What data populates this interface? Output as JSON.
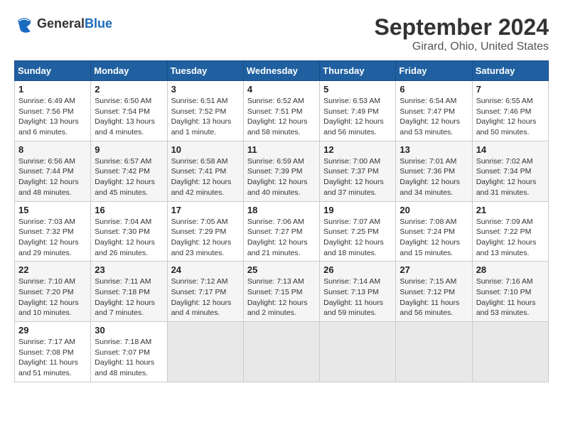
{
  "logo": {
    "general": "General",
    "blue": "Blue"
  },
  "title": "September 2024",
  "subtitle": "Girard, Ohio, United States",
  "weekdays": [
    "Sunday",
    "Monday",
    "Tuesday",
    "Wednesday",
    "Thursday",
    "Friday",
    "Saturday"
  ],
  "weeks": [
    [
      {
        "day": "1",
        "sunrise": "Sunrise: 6:49 AM",
        "sunset": "Sunset: 7:56 PM",
        "daylight": "Daylight: 13 hours and 6 minutes."
      },
      {
        "day": "2",
        "sunrise": "Sunrise: 6:50 AM",
        "sunset": "Sunset: 7:54 PM",
        "daylight": "Daylight: 13 hours and 4 minutes."
      },
      {
        "day": "3",
        "sunrise": "Sunrise: 6:51 AM",
        "sunset": "Sunset: 7:52 PM",
        "daylight": "Daylight: 13 hours and 1 minute."
      },
      {
        "day": "4",
        "sunrise": "Sunrise: 6:52 AM",
        "sunset": "Sunset: 7:51 PM",
        "daylight": "Daylight: 12 hours and 58 minutes."
      },
      {
        "day": "5",
        "sunrise": "Sunrise: 6:53 AM",
        "sunset": "Sunset: 7:49 PM",
        "daylight": "Daylight: 12 hours and 56 minutes."
      },
      {
        "day": "6",
        "sunrise": "Sunrise: 6:54 AM",
        "sunset": "Sunset: 7:47 PM",
        "daylight": "Daylight: 12 hours and 53 minutes."
      },
      {
        "day": "7",
        "sunrise": "Sunrise: 6:55 AM",
        "sunset": "Sunset: 7:46 PM",
        "daylight": "Daylight: 12 hours and 50 minutes."
      }
    ],
    [
      {
        "day": "8",
        "sunrise": "Sunrise: 6:56 AM",
        "sunset": "Sunset: 7:44 PM",
        "daylight": "Daylight: 12 hours and 48 minutes."
      },
      {
        "day": "9",
        "sunrise": "Sunrise: 6:57 AM",
        "sunset": "Sunset: 7:42 PM",
        "daylight": "Daylight: 12 hours and 45 minutes."
      },
      {
        "day": "10",
        "sunrise": "Sunrise: 6:58 AM",
        "sunset": "Sunset: 7:41 PM",
        "daylight": "Daylight: 12 hours and 42 minutes."
      },
      {
        "day": "11",
        "sunrise": "Sunrise: 6:59 AM",
        "sunset": "Sunset: 7:39 PM",
        "daylight": "Daylight: 12 hours and 40 minutes."
      },
      {
        "day": "12",
        "sunrise": "Sunrise: 7:00 AM",
        "sunset": "Sunset: 7:37 PM",
        "daylight": "Daylight: 12 hours and 37 minutes."
      },
      {
        "day": "13",
        "sunrise": "Sunrise: 7:01 AM",
        "sunset": "Sunset: 7:36 PM",
        "daylight": "Daylight: 12 hours and 34 minutes."
      },
      {
        "day": "14",
        "sunrise": "Sunrise: 7:02 AM",
        "sunset": "Sunset: 7:34 PM",
        "daylight": "Daylight: 12 hours and 31 minutes."
      }
    ],
    [
      {
        "day": "15",
        "sunrise": "Sunrise: 7:03 AM",
        "sunset": "Sunset: 7:32 PM",
        "daylight": "Daylight: 12 hours and 29 minutes."
      },
      {
        "day": "16",
        "sunrise": "Sunrise: 7:04 AM",
        "sunset": "Sunset: 7:30 PM",
        "daylight": "Daylight: 12 hours and 26 minutes."
      },
      {
        "day": "17",
        "sunrise": "Sunrise: 7:05 AM",
        "sunset": "Sunset: 7:29 PM",
        "daylight": "Daylight: 12 hours and 23 minutes."
      },
      {
        "day": "18",
        "sunrise": "Sunrise: 7:06 AM",
        "sunset": "Sunset: 7:27 PM",
        "daylight": "Daylight: 12 hours and 21 minutes."
      },
      {
        "day": "19",
        "sunrise": "Sunrise: 7:07 AM",
        "sunset": "Sunset: 7:25 PM",
        "daylight": "Daylight: 12 hours and 18 minutes."
      },
      {
        "day": "20",
        "sunrise": "Sunrise: 7:08 AM",
        "sunset": "Sunset: 7:24 PM",
        "daylight": "Daylight: 12 hours and 15 minutes."
      },
      {
        "day": "21",
        "sunrise": "Sunrise: 7:09 AM",
        "sunset": "Sunset: 7:22 PM",
        "daylight": "Daylight: 12 hours and 13 minutes."
      }
    ],
    [
      {
        "day": "22",
        "sunrise": "Sunrise: 7:10 AM",
        "sunset": "Sunset: 7:20 PM",
        "daylight": "Daylight: 12 hours and 10 minutes."
      },
      {
        "day": "23",
        "sunrise": "Sunrise: 7:11 AM",
        "sunset": "Sunset: 7:18 PM",
        "daylight": "Daylight: 12 hours and 7 minutes."
      },
      {
        "day": "24",
        "sunrise": "Sunrise: 7:12 AM",
        "sunset": "Sunset: 7:17 PM",
        "daylight": "Daylight: 12 hours and 4 minutes."
      },
      {
        "day": "25",
        "sunrise": "Sunrise: 7:13 AM",
        "sunset": "Sunset: 7:15 PM",
        "daylight": "Daylight: 12 hours and 2 minutes."
      },
      {
        "day": "26",
        "sunrise": "Sunrise: 7:14 AM",
        "sunset": "Sunset: 7:13 PM",
        "daylight": "Daylight: 11 hours and 59 minutes."
      },
      {
        "day": "27",
        "sunrise": "Sunrise: 7:15 AM",
        "sunset": "Sunset: 7:12 PM",
        "daylight": "Daylight: 11 hours and 56 minutes."
      },
      {
        "day": "28",
        "sunrise": "Sunrise: 7:16 AM",
        "sunset": "Sunset: 7:10 PM",
        "daylight": "Daylight: 11 hours and 53 minutes."
      }
    ],
    [
      {
        "day": "29",
        "sunrise": "Sunrise: 7:17 AM",
        "sunset": "Sunset: 7:08 PM",
        "daylight": "Daylight: 11 hours and 51 minutes."
      },
      {
        "day": "30",
        "sunrise": "Sunrise: 7:18 AM",
        "sunset": "Sunset: 7:07 PM",
        "daylight": "Daylight: 11 hours and 48 minutes."
      },
      null,
      null,
      null,
      null,
      null
    ]
  ]
}
